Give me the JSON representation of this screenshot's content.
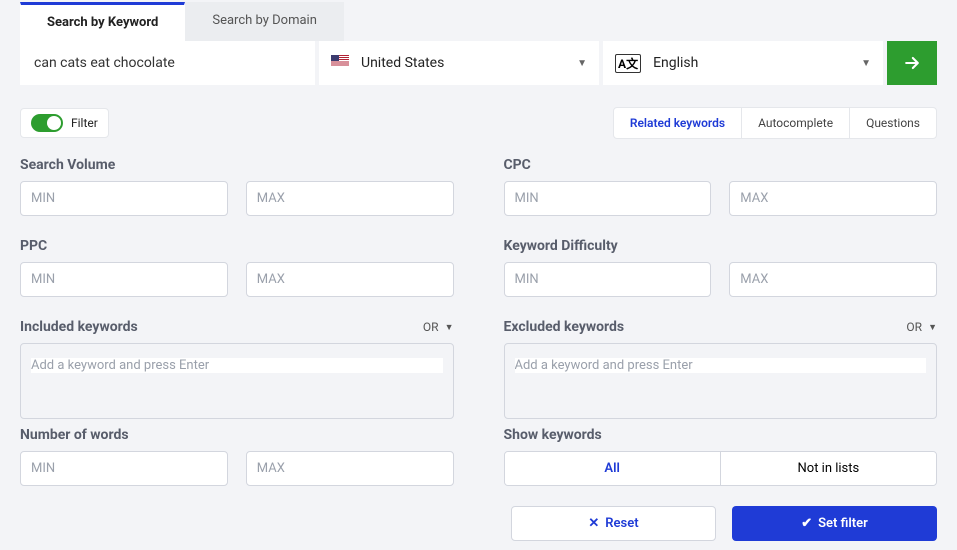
{
  "tabs": {
    "keyword": "Search by Keyword",
    "domain": "Search by Domain"
  },
  "search": {
    "value": "can cats eat chocolate",
    "country": "United States",
    "language": "English"
  },
  "filter_toggle_label": "Filter",
  "pills": {
    "related": "Related keywords",
    "auto": "Autocomplete",
    "questions": "Questions"
  },
  "labels": {
    "search_volume": "Search Volume",
    "cpc": "CPC",
    "ppc": "PPC",
    "kd": "Keyword Difficulty",
    "included": "Included keywords",
    "excluded": "Excluded keywords",
    "num_words": "Number of words",
    "show_kw": "Show keywords"
  },
  "placeholders": {
    "min": "MIN",
    "max": "MAX",
    "kw": "Add a keyword and press Enter"
  },
  "logic": "OR",
  "show": {
    "all": "All",
    "notin": "Not in lists"
  },
  "buttons": {
    "reset": "Reset",
    "set": "Set filter"
  }
}
